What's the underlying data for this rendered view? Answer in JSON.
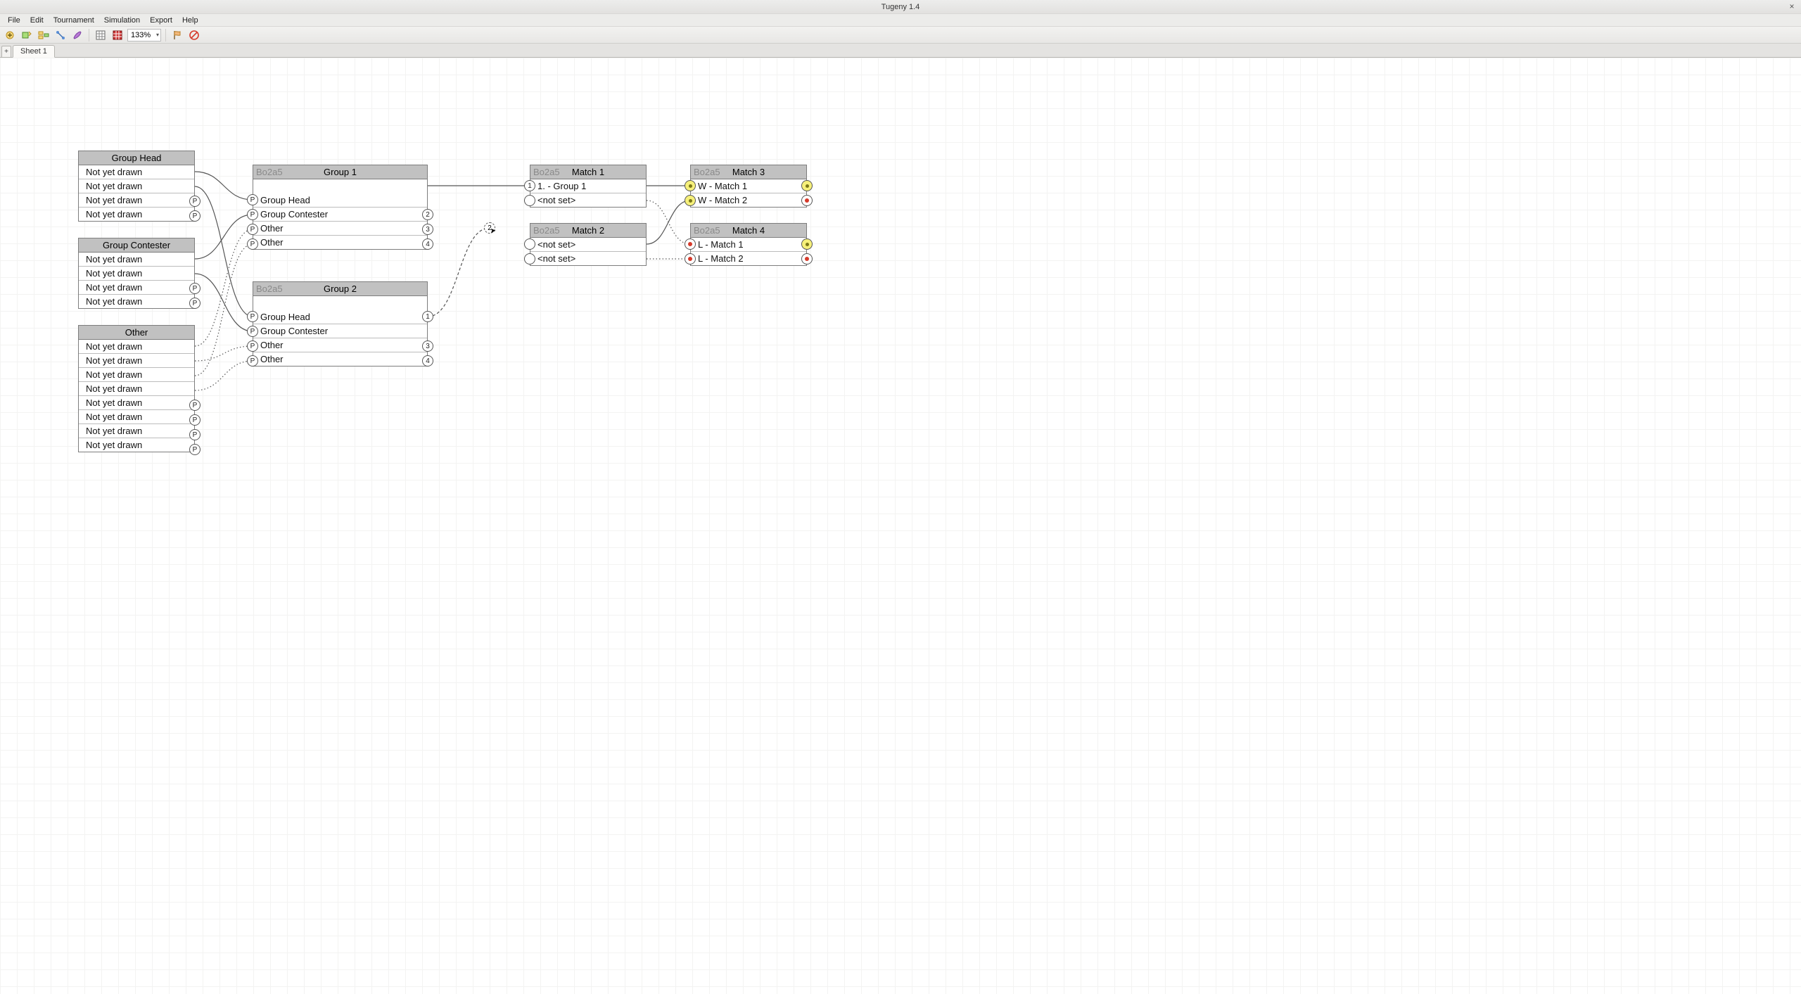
{
  "app": {
    "title": "Tugeny 1.4"
  },
  "menu": [
    "File",
    "Edit",
    "Tournament",
    "Simulation",
    "Export",
    "Help"
  ],
  "toolbar": {
    "zoom": "133%"
  },
  "tabs": {
    "sheet1": "Sheet 1"
  },
  "formatTag": "Bo2a5",
  "pools": {
    "head": {
      "title": "Group Head",
      "rows": [
        "Not yet drawn",
        "Not yet drawn",
        "Not yet drawn",
        "Not yet drawn"
      ]
    },
    "cont": {
      "title": "Group Contester",
      "rows": [
        "Not yet drawn",
        "Not yet drawn",
        "Not yet drawn",
        "Not yet drawn"
      ]
    },
    "other": {
      "title": "Other",
      "rows": [
        "Not yet drawn",
        "Not yet drawn",
        "Not yet drawn",
        "Not yet drawn",
        "Not yet drawn",
        "Not yet drawn",
        "Not yet drawn",
        "Not yet drawn"
      ]
    }
  },
  "groups": {
    "g1": {
      "title": "Group 1",
      "rows": [
        "Group Head",
        "Group Contester",
        "Other",
        "Other"
      ]
    },
    "g2": {
      "title": "Group 2",
      "rows": [
        "Group Head",
        "Group Contester",
        "Other",
        "Other"
      ]
    }
  },
  "matches": {
    "m1": {
      "title": "Match 1",
      "rows": [
        "1. - Group 1",
        "<not set>"
      ]
    },
    "m2": {
      "title": "Match 2",
      "rows": [
        "<not set>",
        "<not set>"
      ]
    },
    "m3": {
      "title": "Match 3",
      "rows": [
        "W - Match 1",
        "W - Match 2"
      ]
    },
    "m4": {
      "title": "Match 4",
      "rows": [
        "L - Match 1",
        "L - Match 2"
      ]
    }
  },
  "floatMarker": "2"
}
